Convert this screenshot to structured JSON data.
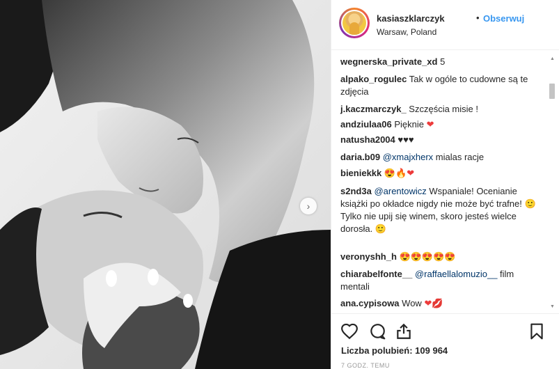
{
  "post": {
    "username": "kasiaszklarczyk",
    "separator": "•",
    "follow_label": "Obserwuj",
    "location": "Warsaw, Poland"
  },
  "comments": [
    {
      "user": "wegnerska_private_xd",
      "text": " 5"
    },
    {
      "user": "alpako_rogulec",
      "text": " Tak w ogóle to cudowne są te zdjęcia"
    },
    {
      "user": "j.kaczmarczyk_",
      "text": " Szczęścia misie !"
    },
    {
      "user": "andziulaa06",
      "text": " Pięknie "
    },
    {
      "user": "natusha2004",
      "text": " ♥♥♥"
    },
    {
      "user": "daria.b09",
      "mention": "@xmajxherx",
      "text": " mialas racje"
    },
    {
      "user": "bieniekkk",
      "text": " "
    },
    {
      "user": "s2nd3a",
      "mention": "@arentowicz",
      "text": " Wspaniale! Ocenianie książki po okładce nigdy nie może być trafne! ",
      "text2": "Tylko nie upij się winem, skoro jesteś wielce dorosła. "
    },
    {
      "user": "veronyshh_h",
      "text": " "
    },
    {
      "user": "chiarabelfonte__",
      "mention": "@raffaellalomuzio__",
      "text": " film mentali"
    },
    {
      "user": "ana.cypisowa",
      "text": " Wow "
    }
  ],
  "likes_label": "Liczba polubień: 109 964",
  "time_label": "7 GODZ. TEMU",
  "icons": {
    "like": "heart-outline-icon",
    "comment": "comment-bubble-icon",
    "share": "share-upload-icon",
    "save": "bookmark-icon",
    "next": "chevron-right-icon"
  },
  "colors": {
    "link": "#3897f0",
    "text": "#262626",
    "heart": "#ed3b3b"
  }
}
